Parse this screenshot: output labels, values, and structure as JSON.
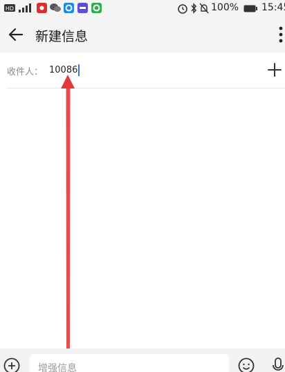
{
  "status_bar": {
    "battery": "100%",
    "time": "15:45",
    "icons": [
      "hd-icon",
      "signal-icon",
      "notification-red-icon",
      "wechat-icon",
      "blue-app-icon",
      "purple-app-icon",
      "green-app-icon",
      "alarm-icon",
      "bluetooth-icon",
      "mute-icon",
      "battery-icon"
    ]
  },
  "header": {
    "title": "新建信息",
    "back_icon": "arrow-left-icon",
    "menu_icon": "more-vertical-icon"
  },
  "recipient": {
    "label": "收件人：",
    "value": "10086",
    "add_icon": "plus-icon"
  },
  "composer": {
    "placeholder": "增强信息",
    "attach_icon": "add-circle-icon",
    "emoji_icon": "emoji-icon",
    "voice_icon": "microphone-icon"
  },
  "colors": {
    "annotation_arrow": "#e03a3a",
    "caret": "#2f7bdc"
  }
}
